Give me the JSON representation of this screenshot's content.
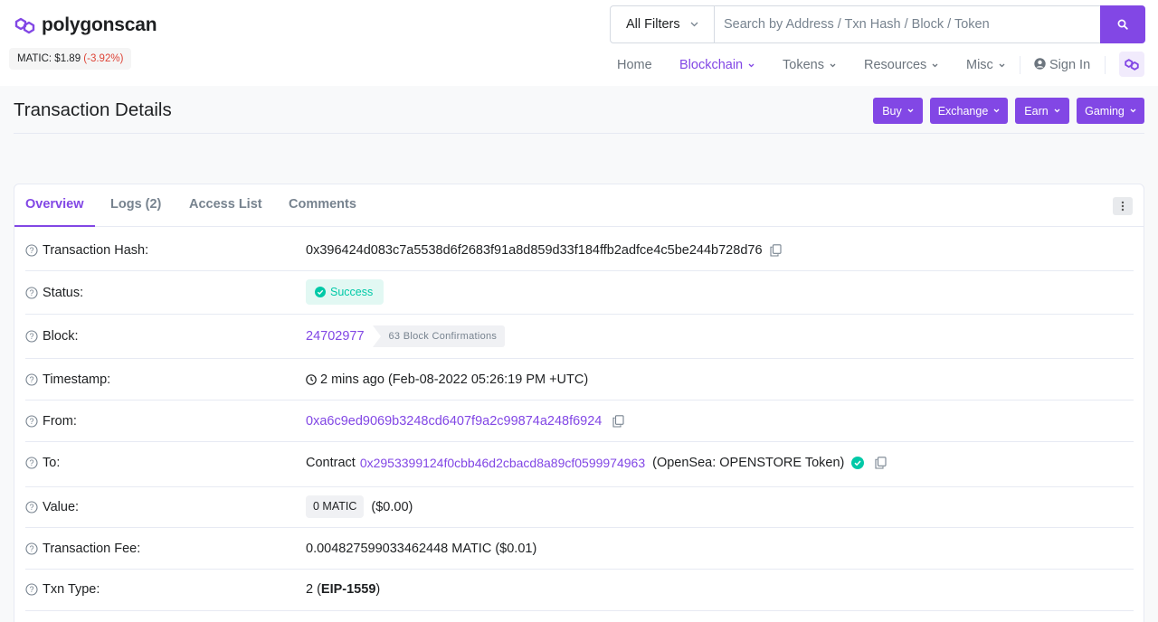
{
  "header": {
    "logo_text": "polygonscan",
    "price": {
      "label": "MATIC: $1.89",
      "change": "(-3.92%)"
    },
    "search": {
      "filter": "All Filters",
      "placeholder": "Search by Address / Txn Hash / Block / Token"
    },
    "nav": [
      {
        "label": "Home"
      },
      {
        "label": "Blockchain"
      },
      {
        "label": "Tokens"
      },
      {
        "label": "Resources"
      },
      {
        "label": "Misc"
      },
      {
        "label": "Sign In"
      }
    ]
  },
  "page": {
    "title": "Transaction Details",
    "ad_buttons": [
      "Buy",
      "Exchange",
      "Earn",
      "Gaming"
    ]
  },
  "tabs": [
    "Overview",
    "Logs (2)",
    "Access List",
    "Comments"
  ],
  "details": {
    "hash": {
      "label": "Transaction Hash:",
      "value": "0x396424d083c7a5538d6f2683f91a8d859d33f184ffb2adfce4c5be244b728d76"
    },
    "status": {
      "label": "Status:",
      "value": "Success"
    },
    "block": {
      "label": "Block:",
      "value": "24702977",
      "confirmations": "63 Block Confirmations"
    },
    "timestamp": {
      "label": "Timestamp:",
      "value": "2 mins ago (Feb-08-2022 05:26:19 PM +UTC)"
    },
    "from": {
      "label": "From:",
      "value": "0xa6c9ed9069b3248cd6407f9a2c99874a248f6924"
    },
    "to": {
      "label": "To:",
      "prefix": "Contract",
      "address": "0x2953399124f0cbb46d2cbacd8a89cf0599974963",
      "name": "(OpenSea: OPENSTORE Token)"
    },
    "value": {
      "label": "Value:",
      "amount": "0 MATIC",
      "usd": "($0.00)"
    },
    "fee": {
      "label": "Transaction Fee:",
      "value": "0.004827599033462448 MATIC ($0.01)"
    },
    "txn_type": {
      "label": "Txn Type:",
      "prefix": "2 (",
      "bold": "EIP-1559",
      "suffix": ")"
    }
  },
  "colors": {
    "accent": "#8247e5",
    "success": "#00c9a7",
    "negative": "#de4437"
  }
}
